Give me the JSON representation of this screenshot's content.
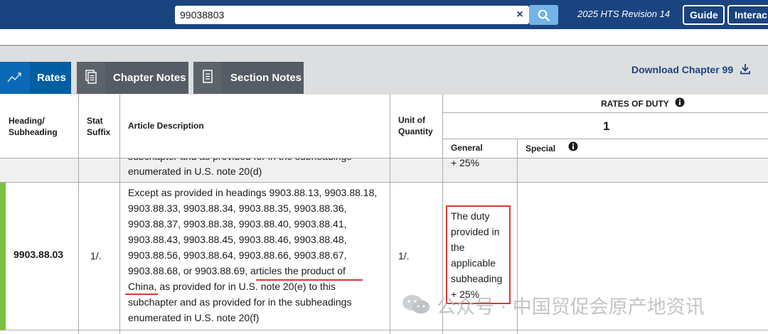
{
  "header": {
    "search_value": "99038803",
    "clear_icon": "×",
    "revision": "2025 HTS Revision 14",
    "guide_label": "Guide",
    "interactive_label": "Interac"
  },
  "tabs": [
    {
      "label": "Rates",
      "icon": "chart-trend-icon",
      "active": true
    },
    {
      "label": "Chapter Notes",
      "icon": "documents-icon",
      "active": false
    },
    {
      "label": "Section Notes",
      "icon": "document-icon",
      "active": false
    }
  ],
  "download_label": "Download Chapter 99",
  "table": {
    "headers": {
      "heading": [
        "Heading/",
        "Subheading"
      ],
      "stat": [
        "Stat",
        "Suffix"
      ],
      "description": "Article Description",
      "unit": [
        "Unit of",
        "Quantity"
      ],
      "rates_of_duty": "RATES OF DUTY",
      "column_number": "1",
      "general": "General",
      "special": "Special"
    },
    "partial_row": {
      "description_line1": "subchapter and as provided for in the subheadings",
      "description_line2": "enumerated in U.S. note 20(d)",
      "general": "+ 25%"
    },
    "row": {
      "heading": "9903.88.03",
      "stat": "1/.",
      "unit": "1/.",
      "description_lines": [
        "Except as provided in headings 9903.88.13, 9903.88.18,",
        "9903.88.33, 9903.88.34, 9903.88.35, 9903.88.36,",
        "9903.88.37, 9903.88.38, 9903.88.40, 9903.88.41,",
        "9903.88.43, 9903.88.45, 9903.88.46, 9903.88.48,",
        "9903.88.56, 9903.88.64, 9903.88.66, 9903.88.67,",
        "9903.88.68, or 9903.88.69, articles the product of",
        "China, as provided for in U.S. note 20(e) to this",
        "subchapter and as provided for in the subheadings",
        "enumerated in U.S. note 20(f)"
      ],
      "general_lines": [
        "The duty",
        "provided in",
        "the",
        "applicable",
        "subheading",
        "+ 25%"
      ]
    }
  },
  "watermark": "公众号 · 中国贸促会原产地资讯",
  "colors": {
    "header_bg": "#1a4480",
    "active_tab": "#005ea2",
    "inactive_tab": "#565c65",
    "highlight_red": "#d83933",
    "row_marker_green": "#7bc142"
  }
}
